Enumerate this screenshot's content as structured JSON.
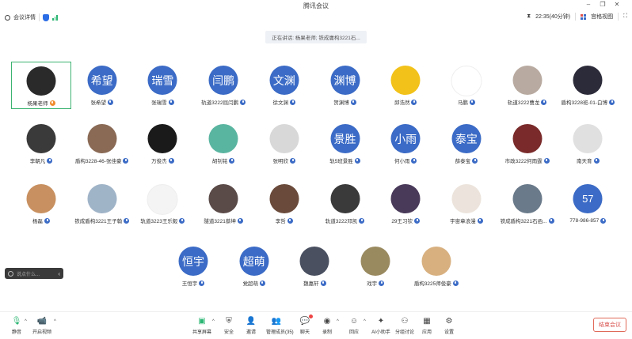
{
  "window": {
    "title": "腾讯会议"
  },
  "toolbar": {
    "meeting_details": "会议详情",
    "time": "22:35(40分钟)",
    "view_mode": "宫格视图"
  },
  "speaking_banner": "正在讲话: 杨果老师; 铁成庸构3221石...",
  "participants": [
    {
      "name": "杨果老师",
      "avatar": "photo",
      "color": "#2a2a2a",
      "active": true,
      "badge": "orange"
    },
    {
      "name": "张希望",
      "avatar": "text",
      "text": "希望"
    },
    {
      "name": "张瑞雪",
      "avatar": "text",
      "text": "瑞雪"
    },
    {
      "name": "轨道3222屈闫鹏",
      "avatar": "text",
      "text": "闫鹏"
    },
    {
      "name": "徐文渊",
      "avatar": "text",
      "text": "文渊"
    },
    {
      "name": "贺渊博",
      "avatar": "text",
      "text": "渊博"
    },
    {
      "name": "邱浩然",
      "avatar": "photo",
      "color": "#f2c21a"
    },
    {
      "name": "马鹏",
      "avatar": "photo",
      "color": "#ffffff"
    },
    {
      "name": "轨道3222曹龙",
      "avatar": "photo",
      "color": "#b8aaa0"
    },
    {
      "name": "盾构3228班-01-白博",
      "avatar": "photo",
      "color": "#2b2b3a"
    },
    {
      "name": "李朝凡",
      "avatar": "photo",
      "color": "#3a3a3a"
    },
    {
      "name": "盾构3228-46-张佳豪",
      "avatar": "photo",
      "color": "#8a6a55"
    },
    {
      "name": "万俊杰",
      "avatar": "photo",
      "color": "#1a1a1a"
    },
    {
      "name": "胡钊铭",
      "avatar": "photo",
      "color": "#5ab5a0"
    },
    {
      "name": "张明欣",
      "avatar": "photo",
      "color": "#d8d8d8"
    },
    {
      "name": "轨5班景胜",
      "avatar": "text",
      "text": "景胜"
    },
    {
      "name": "何小雨",
      "avatar": "text",
      "text": "小雨"
    },
    {
      "name": "薛泰宝",
      "avatar": "text",
      "text": "泰宝"
    },
    {
      "name": "市政3222何雨霆",
      "avatar": "photo",
      "color": "#7a2a2a"
    },
    {
      "name": "南天育",
      "avatar": "photo",
      "color": "#e0e0e0"
    },
    {
      "name": "杨磊",
      "avatar": "photo",
      "color": "#c89060"
    },
    {
      "name": "铁成盾构3221王子翰",
      "avatar": "photo",
      "color": "#a0b4c8"
    },
    {
      "name": "轨道3223王乐毅",
      "avatar": "photo",
      "color": "#f4f4f4"
    },
    {
      "name": "隧道3221蔡坤",
      "avatar": "photo",
      "color": "#5a4a48"
    },
    {
      "name": "李哲",
      "avatar": "photo",
      "color": "#6a4a3a"
    },
    {
      "name": "轨道3222邓凯",
      "avatar": "photo",
      "color": "#3a3a3a"
    },
    {
      "name": "29王习钦",
      "avatar": "photo",
      "color": "#4a3a5a"
    },
    {
      "name": "宇宙章浪漫",
      "avatar": "photo",
      "color": "#ece4dc"
    },
    {
      "name": "铁成盾构3221石函...",
      "avatar": "photo",
      "color": "#6a7a8a"
    },
    {
      "name": "778-986-857",
      "avatar": "num",
      "text": "57"
    },
    {
      "name": "王恒宇",
      "avatar": "text",
      "text": "恒宇"
    },
    {
      "name": "党超萌",
      "avatar": "text",
      "text": "超萌"
    },
    {
      "name": "魏嘉轩",
      "avatar": "photo",
      "color": "#4a5060"
    },
    {
      "name": "戏宇",
      "avatar": "photo",
      "color": "#9a8a60"
    },
    {
      "name": "盾构3225师俊豪",
      "avatar": "photo",
      "color": "#d8b080"
    }
  ],
  "chat": {
    "placeholder": "说点什么..."
  },
  "bottom": {
    "mute": "静音",
    "video": "开启视频",
    "share": "共享屏幕",
    "security": "安全",
    "invite": "邀请",
    "members": "管理成员(35)",
    "chat": "聊天",
    "record": "录制",
    "replay": "回应",
    "ai": "AI小助手",
    "breakout": "分组讨论",
    "apps": "应用",
    "settings": "设置",
    "end": "结束会议"
  }
}
